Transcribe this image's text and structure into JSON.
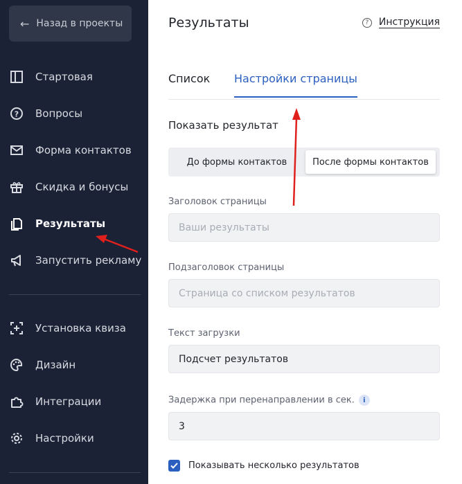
{
  "sidebar": {
    "back_label": "Назад в проекты",
    "items": [
      {
        "label": "Стартовая",
        "icon": "layout-icon"
      },
      {
        "label": "Вопросы",
        "icon": "question-icon"
      },
      {
        "label": "Форма контактов",
        "icon": "mail-icon"
      },
      {
        "label": "Скидка и бонусы",
        "icon": "gift-icon"
      },
      {
        "label": "Результаты",
        "icon": "results-icon",
        "active": true
      },
      {
        "label": "Запустить рекламу",
        "icon": "megaphone-icon"
      },
      {
        "label": "Установка квиза",
        "icon": "install-icon"
      },
      {
        "label": "Дизайн",
        "icon": "palette-icon"
      },
      {
        "label": "Интеграции",
        "icon": "puzzle-icon"
      },
      {
        "label": "Настройки",
        "icon": "gear-icon"
      }
    ]
  },
  "header": {
    "title": "Результаты",
    "instruction_label": "Инструкция"
  },
  "tabs": [
    {
      "label": "Список"
    },
    {
      "label": "Настройки страницы",
      "active": true
    }
  ],
  "show_result": {
    "title": "Показать результат",
    "options": [
      "До формы контактов",
      "После формы контактов"
    ],
    "selected": "После формы контактов"
  },
  "fields": {
    "page_title": {
      "label": "Заголовок страницы",
      "placeholder": "Ваши результаты"
    },
    "page_subtitle": {
      "label": "Подзаголовок страницы",
      "placeholder": "Страница со списком результатов"
    },
    "loading_text": {
      "label": "Текст загрузки",
      "value": "Подсчет результатов"
    },
    "redirect_delay": {
      "label": "Задержка при перенаправлении в сек.",
      "value": "3"
    }
  },
  "checkbox": {
    "label": "Показывать несколько результатов",
    "checked": true
  },
  "colors": {
    "sidebar_bg": "#1b2236",
    "accent": "#2b5fbf",
    "annotation_arrow": "#e0201c"
  }
}
